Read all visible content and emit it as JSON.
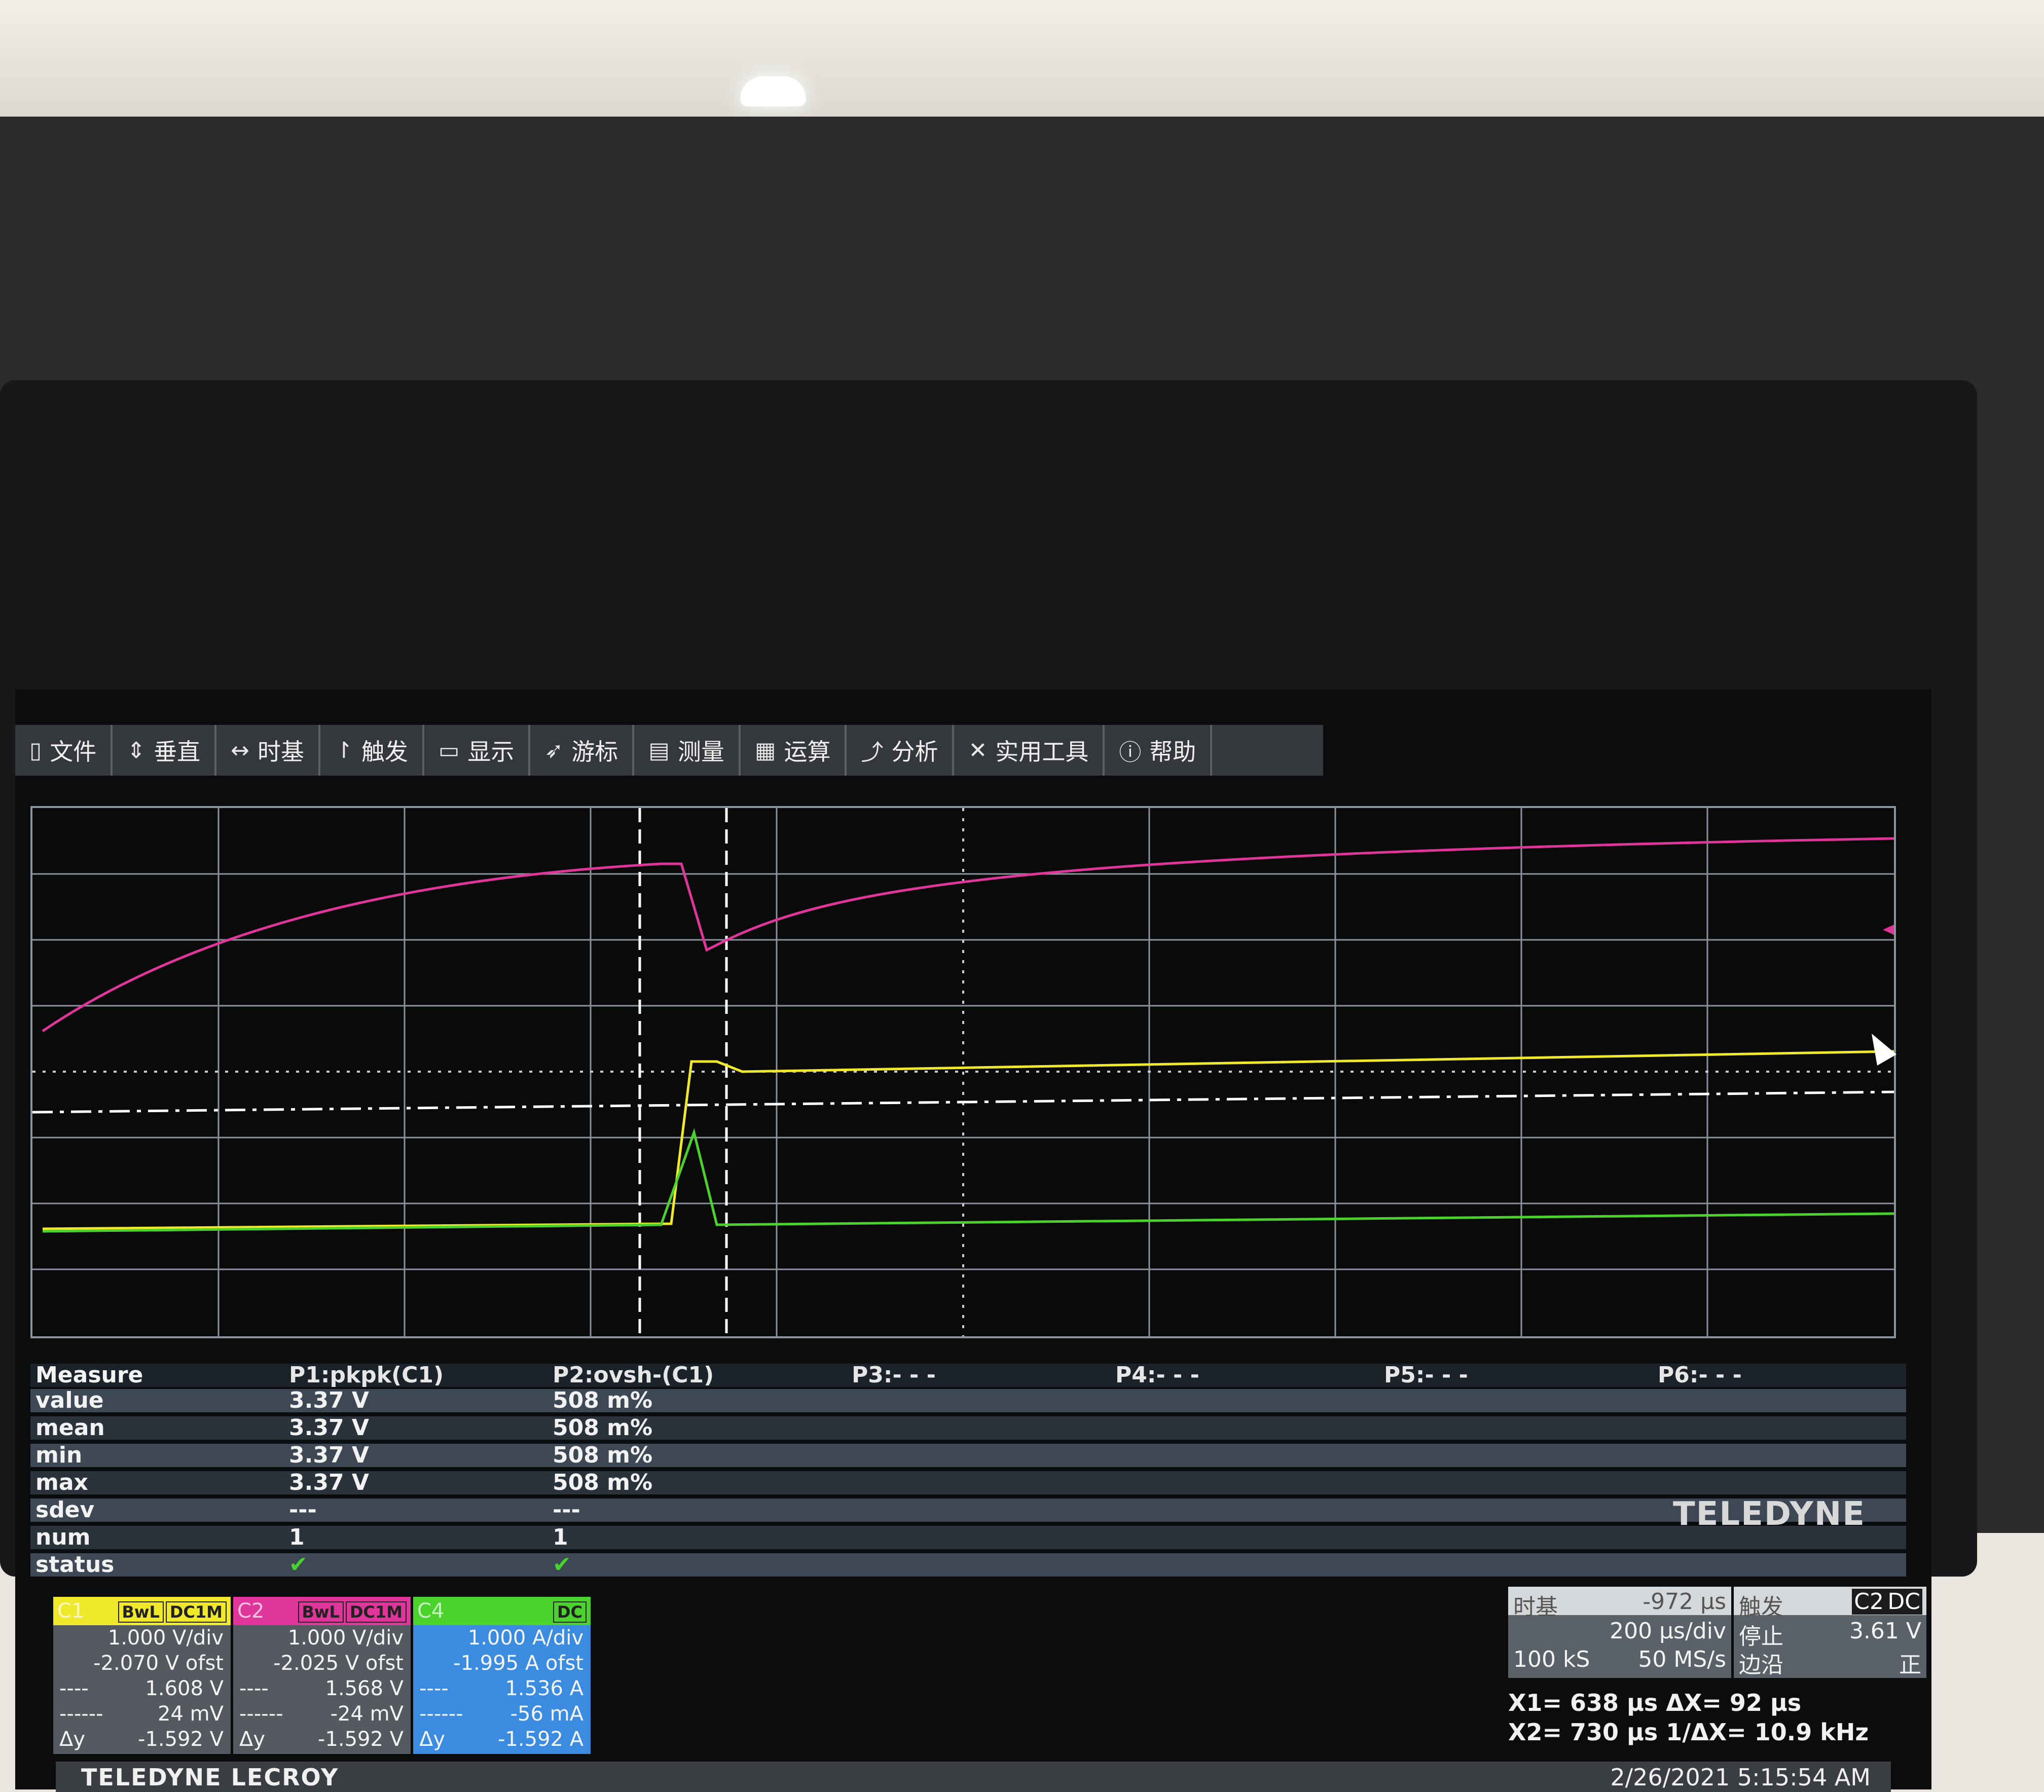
{
  "menu": [
    {
      "label": "文件",
      "icon": "file-icon",
      "glyph": "▯"
    },
    {
      "label": "垂直",
      "icon": "vertical-icon",
      "glyph": "⇕"
    },
    {
      "label": "时基",
      "icon": "timebase-icon",
      "glyph": "↔"
    },
    {
      "label": "触发",
      "icon": "trigger-icon",
      "glyph": "↾"
    },
    {
      "label": "显示",
      "icon": "display-icon",
      "glyph": "▭"
    },
    {
      "label": "游标",
      "icon": "cursor-icon",
      "glyph": "➶"
    },
    {
      "label": "测量",
      "icon": "measure-icon",
      "glyph": "▤"
    },
    {
      "label": "运算",
      "icon": "math-icon",
      "glyph": "▦"
    },
    {
      "label": "分析",
      "icon": "analysis-icon",
      "glyph": "⤴"
    },
    {
      "label": "实用工具",
      "icon": "utilities-icon",
      "glyph": "✕"
    },
    {
      "label": "帮助",
      "icon": "help-icon",
      "glyph": "ⓘ"
    }
  ],
  "measure": {
    "header": {
      "label": "Measure",
      "p1": "P1:pkpk(C1)",
      "p2": "P2:ovsh-(C1)",
      "p3": "P3:- - -",
      "p4": "P4:- - -",
      "p5": "P5:- - -",
      "p6": "P6:- - -"
    },
    "rows": [
      {
        "label": "value",
        "p1": "3.37 V",
        "p2": "508 m%"
      },
      {
        "label": "mean",
        "p1": "3.37 V",
        "p2": "508 m%"
      },
      {
        "label": "min",
        "p1": "3.37 V",
        "p2": "508 m%"
      },
      {
        "label": "max",
        "p1": "3.37 V",
        "p2": "508 m%"
      },
      {
        "label": "sdev",
        "p1": "---",
        "p2": "---"
      },
      {
        "label": "num",
        "p1": "1",
        "p2": "1"
      },
      {
        "label": "status",
        "p1": "✔",
        "p2": "✔"
      }
    ]
  },
  "channels": {
    "c1": {
      "name": "C1",
      "tag1": "BwL",
      "tag2": "DC1M",
      "vdiv": "1.000 V/div",
      "ofst": "-2.070 V ofst",
      "cur1": "1.608 V",
      "cur2": "24 mV",
      "dy_label": "Δy",
      "dy": "-1.592 V",
      "cur1_label": "----",
      "cur2_label": "------"
    },
    "c2": {
      "name": "C2",
      "tag1": "BwL",
      "tag2": "DC1M",
      "vdiv": "1.000 V/div",
      "ofst": "-2.025 V ofst",
      "cur1": "1.568 V",
      "cur2": "-24 mV",
      "dy_label": "Δy",
      "dy": "-1.592 V",
      "cur1_label": "----",
      "cur2_label": "------"
    },
    "c4": {
      "name": "C4",
      "tag1": "DC",
      "vdiv": "1.000 A/div",
      "ofst": "-1.995 A ofst",
      "cur1": "1.536 A",
      "cur2": "-56 mA",
      "dy_label": "Δy",
      "dy": "-1.592 A",
      "cur1_label": "----",
      "cur2_label": "------"
    }
  },
  "timebase": {
    "title": "时基",
    "delay": "-972 µs",
    "tdiv": "200 µs/div",
    "samples": "100 kS",
    "rate": "50 MS/s"
  },
  "trigger": {
    "title": "触发",
    "src": "C2",
    "coupling": "DC",
    "mode": "停止",
    "level": "3.61 V",
    "type": "边沿",
    "slope": "正"
  },
  "cursors": {
    "x1": "X1= 638 µs ΔX= 92 µs",
    "x2": "X2= 730 µs 1/ΔX= 10.9 kHz"
  },
  "footer": {
    "brand": "TELEDYNE LECROY",
    "datetime": "2/26/2021 5:15:54 AM"
  },
  "bezel_brand": "TELEDYNE",
  "colors": {
    "c1": "#f0e82a",
    "c2": "#e0359a",
    "c4": "#4cd22d"
  }
}
